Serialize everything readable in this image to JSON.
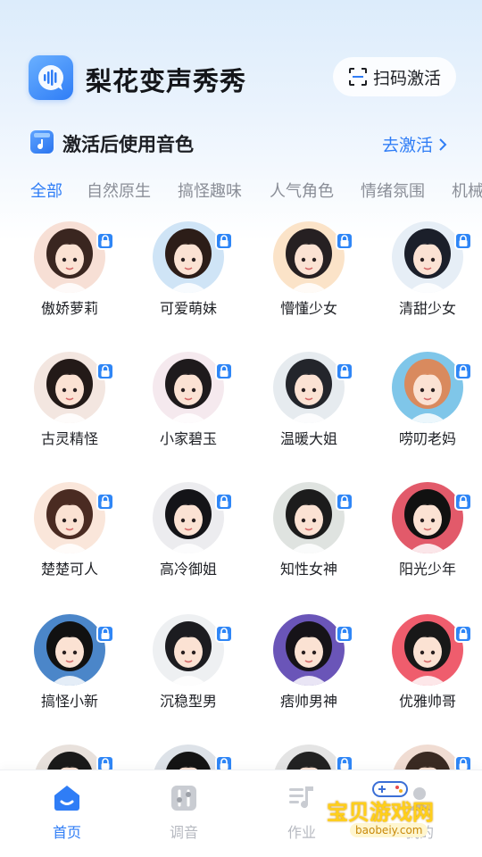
{
  "app": {
    "title": "梨花变声秀秀",
    "scan_button": "扫码激活"
  },
  "section": {
    "title": "激活后使用音色",
    "action": "去激活"
  },
  "tabs": [
    {
      "label": "全部",
      "active": true
    },
    {
      "label": "自然原生",
      "active": false
    },
    {
      "label": "搞怪趣味",
      "active": false
    },
    {
      "label": "人气角色",
      "active": false
    },
    {
      "label": "情绪氛围",
      "active": false
    },
    {
      "label": "机械",
      "active": false
    }
  ],
  "voices": [
    {
      "name": "傲娇萝莉",
      "bg": "#f7dfd5",
      "hair": "#3a2620",
      "locked": true
    },
    {
      "name": "可爱萌妹",
      "bg": "#cfe4f6",
      "hair": "#2c1d18",
      "locked": true
    },
    {
      "name": "懵懂少女",
      "bg": "#fbe3c8",
      "hair": "#262022",
      "locked": true
    },
    {
      "name": "清甜少女",
      "bg": "#e6eef6",
      "hair": "#1b1f2a",
      "locked": true
    },
    {
      "name": "古灵精怪",
      "bg": "#f3e6e0",
      "hair": "#231a18",
      "locked": true
    },
    {
      "name": "小家碧玉",
      "bg": "#f5e9ee",
      "hair": "#1e1a1c",
      "locked": true
    },
    {
      "name": "温暖大姐",
      "bg": "#e6ebef",
      "hair": "#23252b",
      "locked": true
    },
    {
      "name": "唠叨老妈",
      "bg": "#7fc6e9",
      "hair": "#d98a5e",
      "locked": true
    },
    {
      "name": "楚楚可人",
      "bg": "#fae6da",
      "hair": "#4a2b22",
      "locked": true
    },
    {
      "name": "高冷御姐",
      "bg": "#ececef",
      "hair": "#141418",
      "locked": true
    },
    {
      "name": "知性女神",
      "bg": "#dfe3e0",
      "hair": "#1c1c1c",
      "locked": true
    },
    {
      "name": "阳光少年",
      "bg": "#e25a6a",
      "hair": "#111111",
      "locked": true
    },
    {
      "name": "搞怪小新",
      "bg": "#4b86c9",
      "hair": "#111111",
      "locked": true
    },
    {
      "name": "沉稳型男",
      "bg": "#eef0f2",
      "hair": "#1c1c20",
      "locked": true
    },
    {
      "name": "痞帅男神",
      "bg": "#6a55b8",
      "hair": "#161318",
      "locked": true
    },
    {
      "name": "优雅帅哥",
      "bg": "#ef5d6d",
      "hair": "#181818",
      "locked": true
    },
    {
      "name": "",
      "bg": "#e8e1dc",
      "hair": "#1a1a1a",
      "locked": true
    },
    {
      "name": "",
      "bg": "#dde2e8",
      "hair": "#141414",
      "locked": true
    },
    {
      "name": "",
      "bg": "#e4e4e4",
      "hair": "#222222",
      "locked": true
    },
    {
      "name": "",
      "bg": "#f0dcd2",
      "hair": "#3a2a22",
      "locked": true
    }
  ],
  "nav": [
    {
      "label": "首页",
      "icon": "home-icon",
      "active": true
    },
    {
      "label": "调音",
      "icon": "mixer-icon",
      "active": false
    },
    {
      "label": "作业",
      "icon": "music-list-icon",
      "active": false
    },
    {
      "label": "我的",
      "icon": "profile-icon",
      "active": false
    }
  ],
  "watermark": {
    "main": "宝贝游戏网",
    "sub": "baobeiy.com"
  },
  "colors": {
    "accent": "#2f7df6",
    "inactive": "#8a8e97"
  }
}
